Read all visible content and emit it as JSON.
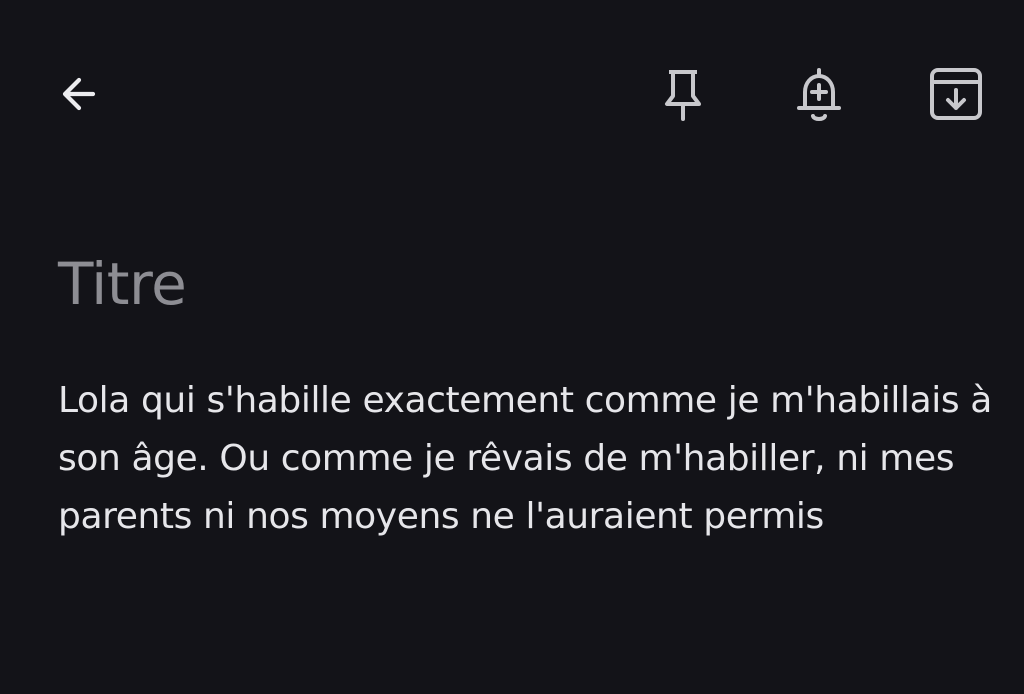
{
  "toolbar": {
    "back_icon": "arrow-back-icon",
    "pin_icon": "pin-icon",
    "reminder_icon": "bell-plus-icon",
    "archive_icon": "archive-icon"
  },
  "note": {
    "title_placeholder": "Titre",
    "body": "Lola qui s'habille exactement comme je m'habillais à son âge. Ou comme je rêvais de m'habiller, ni mes parents ni nos moyens ne l'auraient permis"
  },
  "colors": {
    "background": "#131318",
    "icon": "#c8c8cc",
    "title_placeholder": "#8d8d93",
    "body_text": "#e6e6ea"
  }
}
